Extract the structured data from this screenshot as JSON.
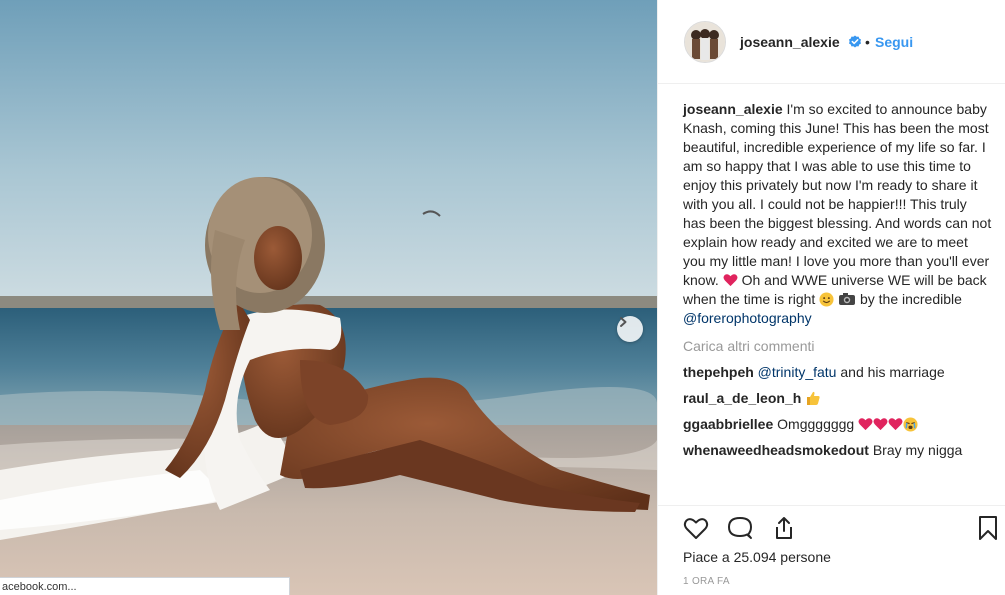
{
  "post": {
    "username": "joseann_alexie",
    "dot": "•",
    "follow_label": "Segui",
    "caption_text_1": "I'm so excited to announce baby Knash, coming this June! This has been the most beautiful, incredible experience of my life so far. I am so happy that I was able to use this time to enjoy this privately but now I'm ready to share it with you all. I could not be happier!!! This truly has been the biggest blessing. And words can not explain how ready and excited we are to meet you my little man! I love you more than you'll ever know.",
    "caption_text_2": "Oh and WWE universe WE will be back when the time is right",
    "caption_text_3": "by the incredible",
    "caption_mention": "@forerophotography",
    "load_more_label": "Carica altri commenti",
    "likes_text": "Piace a 25.094 persone",
    "time_text": "1 ORA FA"
  },
  "comments": [
    {
      "user": "thepehpeh",
      "mention": "@trinity_fatu",
      "text": " and his marriage"
    },
    {
      "user": "raul_a_de_leon_h",
      "text": ""
    },
    {
      "user": "ggaabbriellee",
      "text": "Omggggggg"
    },
    {
      "user": "whenaweedheadsmokedout",
      "text": "Bray my nigga"
    }
  ],
  "browser": {
    "status_url": "acebook.com..."
  },
  "icons": {
    "like": "heart-outline-icon",
    "comment": "speech-bubble-icon",
    "share": "share-upload-icon",
    "save": "bookmark-icon",
    "next": "chevron-right-icon",
    "verified": "verified-badge-icon"
  },
  "colors": {
    "link": "#3897f0",
    "mention": "#003569",
    "verified": "#3897f0",
    "heart_emoji": "#e0245e"
  }
}
